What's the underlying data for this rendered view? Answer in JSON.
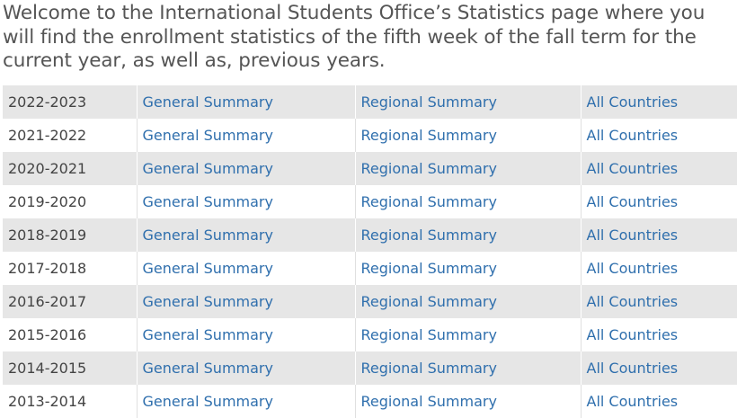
{
  "intro": "Welcome to the International Students Office’s Statistics page where you will find the enrollment statistics of the fifth week of the fall term for the current year, as well as, previous years.",
  "links": {
    "general": "General Summary",
    "regional": "Regional Summary",
    "countries": "All Countries"
  },
  "rows": [
    {
      "year": "2022-2023"
    },
    {
      "year": "2021-2022"
    },
    {
      "year": "2020-2021"
    },
    {
      "year": "2019-2020"
    },
    {
      "year": "2018-2019"
    },
    {
      "year": "2017-2018"
    },
    {
      "year": "2016-2017"
    },
    {
      "year": "2015-2016"
    },
    {
      "year": "2014-2015"
    },
    {
      "year": "2013-2014"
    }
  ],
  "colors": {
    "link": "#2f6fad",
    "text": "#555555",
    "stripe": "#e6e6e6"
  }
}
